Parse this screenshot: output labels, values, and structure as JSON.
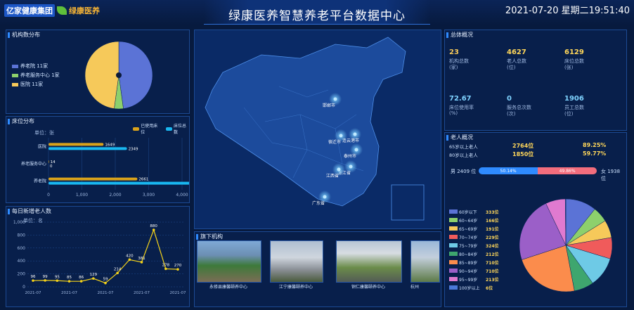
{
  "header": {
    "logo_primary": "亿家健康集团",
    "logo_secondary": "绿康医养",
    "title": "绿康医养智慧养老平台数据中心",
    "datetime": "2021-07-20 星期二19:51:40"
  },
  "institution_distribution": {
    "title": "机构数分布",
    "legend": [
      {
        "label": "养老院 11家",
        "color": "#5b73d6"
      },
      {
        "label": "养老服务中心 1家",
        "color": "#8dd06c"
      },
      {
        "label": "医院 11家",
        "color": "#f6c95a"
      }
    ],
    "chart_data": {
      "type": "pie",
      "labels": [
        "养老院",
        "养老服务中心",
        "医院"
      ],
      "values": [
        11,
        1,
        11
      ],
      "colors": [
        "#5b73d6",
        "#8dd06c",
        "#f6c95a"
      ]
    }
  },
  "bed_distribution": {
    "title": "床位分布",
    "unit": "单位：张",
    "legend": [
      {
        "label": "已使用床位",
        "color": "#d9a21b"
      },
      {
        "label": "床位总数",
        "color": "#19b7f0"
      }
    ],
    "chart_data": {
      "type": "bar",
      "orientation": "horizontal",
      "categories": [
        "医院",
        "养老服务中心",
        "养老院"
      ],
      "series": [
        {
          "name": "已使用床位",
          "values": [
            1649,
            14,
            2661
          ]
        },
        {
          "name": "床位总数",
          "values": [
            2349,
            0,
            8730
          ]
        }
      ],
      "data_labels": [
        [
          "1649",
          "2349"
        ],
        [
          "14",
          "0"
        ],
        [
          "2661",
          "8730"
        ]
      ],
      "xlim": [
        0,
        4000
      ],
      "xticks": [
        "0",
        "1,000",
        "2,000",
        "3,000",
        "4,000"
      ]
    }
  },
  "daily_new_elderly": {
    "title": "每日新增老人数",
    "unit": "单位：名",
    "chart_data": {
      "type": "line",
      "x": [
        "2021-07-01",
        "2021-07-02",
        "2021-07-03",
        "2021-07-04",
        "2021-07-05",
        "2021-07-06",
        "2021-07-07",
        "2021-07-08",
        "2021-07-09",
        "2021-07-10",
        "2021-07-11",
        "2021-07-12",
        "2021-07-13"
      ],
      "y": [
        96,
        99,
        95,
        85,
        86,
        129,
        59,
        214,
        420,
        381,
        880,
        278,
        270
      ],
      "ylim": [
        0,
        1000
      ],
      "yticks": [
        "0",
        "200",
        "400",
        "600",
        "800",
        "1,000"
      ],
      "xticks": [
        "2021-07",
        "2021-07",
        "2021-07",
        "2021-07",
        "2021-07"
      ],
      "color": "#f4d21a"
    }
  },
  "map_labels": [
    {
      "text": "邯郸市"
    },
    {
      "text": "连云港市"
    },
    {
      "text": "宿迁市"
    },
    {
      "text": "泰州市"
    },
    {
      "text": "浙江省"
    },
    {
      "text": "江西省"
    },
    {
      "text": "广东省"
    }
  ],
  "institutions": {
    "title": "旗下机构",
    "items": [
      {
        "name": "永修县康馨颐养中心"
      },
      {
        "name": "江宁康馨颐养中心"
      },
      {
        "name": "铜仁康馨颐养中心"
      },
      {
        "name": "杭州"
      }
    ]
  },
  "overview": {
    "title": "总体概况",
    "kpis": [
      {
        "value": "23",
        "label": "机构总数",
        "unit": "(家)"
      },
      {
        "value": "4627",
        "label": "老人总数",
        "unit": "(位)"
      },
      {
        "value": "6129",
        "label": "床位总数",
        "unit": "(张)"
      },
      {
        "value": "72.67",
        "label": "床位使用率",
        "unit": "(%)"
      },
      {
        "value": "0",
        "label": "服务总次数",
        "unit": "(次)"
      },
      {
        "value": "1906",
        "label": "员工总数",
        "unit": "(位)"
      }
    ]
  },
  "elderly_overview": {
    "title": "老人概况",
    "rows": [
      {
        "label": "65岁以上老人",
        "count": "2764位",
        "pct": "89.25%"
      },
      {
        "label": "80岁以上老人",
        "count": "1850位",
        "pct": "59.77%"
      }
    ],
    "gender": {
      "male_label": "男 2409 位",
      "female_label": "女 1938 位",
      "male_pct": 50.14,
      "female_pct": 49.86,
      "male_text": "50.14%",
      "female_text": "49.86%",
      "male_color": "#2f8bff",
      "female_color": "#f26d7d"
    },
    "age_legend": [
      {
        "label": "60岁以下",
        "count": "333位",
        "color": "#5b73d6"
      },
      {
        "label": "60~64岁",
        "count": "166位",
        "color": "#8dd06c"
      },
      {
        "label": "65~69岁",
        "count": "191位",
        "color": "#f6c95a"
      },
      {
        "label": "70~74岁",
        "count": "229位",
        "color": "#f05b5b"
      },
      {
        "label": "75~79岁",
        "count": "324位",
        "color": "#6ecae6"
      },
      {
        "label": "80~84岁",
        "count": "212位",
        "color": "#3ea66e"
      },
      {
        "label": "85~89岁",
        "count": "710位",
        "color": "#fb8c4c"
      },
      {
        "label": "90~94岁",
        "count": "710位",
        "color": "#9b5fc8"
      },
      {
        "label": "95~99岁",
        "count": "213位",
        "color": "#e07ad0"
      },
      {
        "label": "100岁以上",
        "count": "6位",
        "color": "#4a78d8"
      }
    ],
    "chart_data": {
      "type": "pie",
      "labels": [
        "60岁以下",
        "60~64岁",
        "65~69岁",
        "70~74岁",
        "75~79岁",
        "80~84岁",
        "85~89岁",
        "90~94岁",
        "95~99岁",
        "100岁以上"
      ],
      "values": [
        333,
        166,
        191,
        229,
        324,
        212,
        710,
        710,
        213,
        6
      ]
    }
  }
}
